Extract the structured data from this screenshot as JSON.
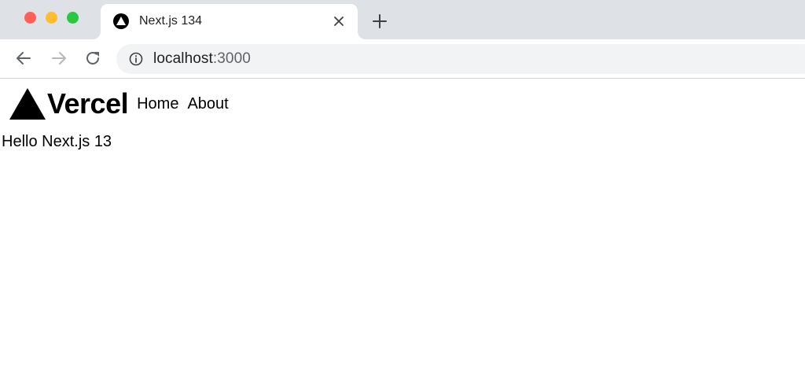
{
  "browser": {
    "tab": {
      "title": "Next.js 134"
    },
    "address_bar": {
      "host": "localhost",
      "port": ":3000"
    }
  },
  "page": {
    "logo_text": "Vercel",
    "nav": {
      "home": "Home",
      "about": "About"
    },
    "heading": "Hello Next.js 13"
  },
  "colors": {
    "tabstrip_bg": "#dee1e6",
    "close_dot": "#fe5f57",
    "minimize_dot": "#febc2e",
    "maximize_dot": "#28c840"
  },
  "icons": {
    "favicon": "vercel-triangle-icon",
    "tab_close": "close-icon",
    "new_tab": "plus-icon",
    "back": "arrow-left-icon",
    "forward": "arrow-right-icon",
    "reload": "reload-icon",
    "site_info": "info-icon"
  }
}
